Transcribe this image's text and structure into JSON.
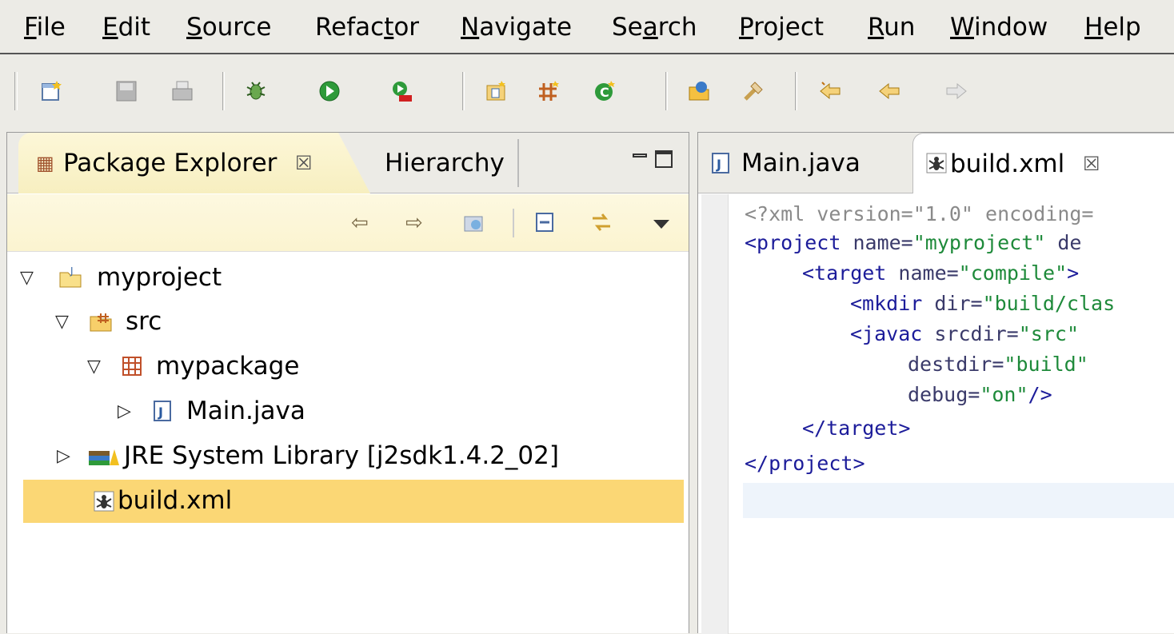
{
  "menus": [
    {
      "label": "File",
      "u": "F",
      "rest": "ile"
    },
    {
      "label": "Edit",
      "u": "E",
      "rest": "dit"
    },
    {
      "label": "Source",
      "u": "S",
      "rest": "ource"
    },
    {
      "label": "Refactor",
      "pre": "Refac",
      "u": "t",
      "rest": "or"
    },
    {
      "label": "Navigate",
      "u": "N",
      "rest": "avigate"
    },
    {
      "label": "Search",
      "pre": "Se",
      "u": "a",
      "rest": "rch"
    },
    {
      "label": "Project",
      "u": "P",
      "rest": "roject"
    },
    {
      "label": "Run",
      "u": "R",
      "rest": "un"
    },
    {
      "label": "Window",
      "u": "W",
      "rest": "indow"
    },
    {
      "label": "Help",
      "u": "H",
      "rest": "elp"
    }
  ],
  "left_panel": {
    "tabs": [
      {
        "label": "Package Explorer",
        "close": "☒",
        "icon": "package-explorer-icon"
      },
      {
        "label": "Hierarchy"
      }
    ],
    "tree": [
      {
        "label": "myproject",
        "expanded": true,
        "icon": "project-folder-icon"
      },
      {
        "label": "src",
        "expanded": true,
        "icon": "source-folder-icon"
      },
      {
        "label": "mypackage",
        "expanded": true,
        "icon": "package-icon"
      },
      {
        "label": "Main.java",
        "expanded": false,
        "icon": "java-file-icon"
      },
      {
        "label": "JRE System Library [j2sdk1.4.2_02]",
        "expanded": false,
        "icon": "library-icon"
      },
      {
        "label": "build.xml",
        "selected": true,
        "icon": "ant-file-icon"
      }
    ]
  },
  "editor": {
    "tabs": [
      {
        "label": "Main.java",
        "icon": "java-file-icon"
      },
      {
        "label": "build.xml",
        "close": "☒",
        "icon": "ant-file-icon",
        "active": true
      }
    ],
    "code": {
      "l1": {
        "a": "<?xml version=\"1.0\" encoding="
      },
      "l2": {
        "a": "<project",
        "b": " name=",
        "c": "\"myproject\"",
        "d": " de"
      },
      "l3": {
        "a": "<target",
        "b": " name=",
        "c": "\"compile\"",
        "d": ">"
      },
      "l4": {
        "a": "<mkdir",
        "b": " dir=",
        "c": "\"build/clas"
      },
      "l5": {
        "a": "<javac",
        "b": " srcdir=",
        "c": "\"src\""
      },
      "l6": {
        "b": "destdir=",
        "c": "\"build\""
      },
      "l7": {
        "b": "debug=",
        "c": "\"on\"",
        "d": "/>"
      },
      "l8": {
        "a": "</target>"
      },
      "l9": {
        "a": "</project>"
      }
    }
  },
  "colors": {
    "selection": "#fbd775",
    "tab_active": "#f7efc0"
  }
}
